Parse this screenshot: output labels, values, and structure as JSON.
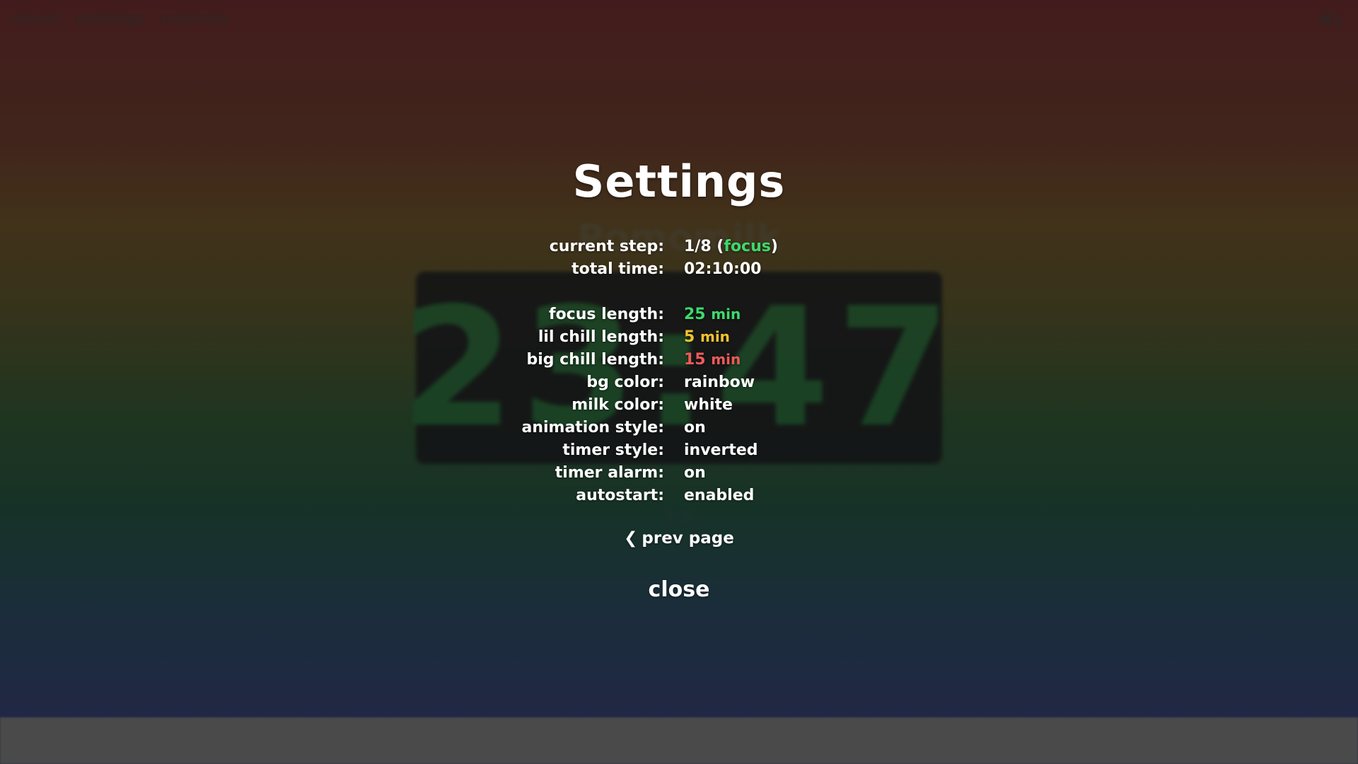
{
  "background": {
    "nav": {
      "about": "about",
      "settings": "settings",
      "controls": "controls"
    },
    "app_title": "Pomomilk",
    "timer": "23:47",
    "step": "1/8"
  },
  "settings": {
    "title": "Settings",
    "current_step_label": "current step:",
    "current_step_value": "1/8 (",
    "current_step_phase": "focus",
    "current_step_close": ")",
    "total_time_label": "total time:",
    "total_time_value": "02:10:00",
    "focus_length_label": "focus length:",
    "focus_length_value": "25",
    "focus_length_unit": "min",
    "lil_chill_label": "lil chill length:",
    "lil_chill_value": "5",
    "lil_chill_unit": "min",
    "big_chill_label": "big chill length:",
    "big_chill_value": "15",
    "big_chill_unit": "min",
    "bg_color_label": "bg color:",
    "bg_color_value": "rainbow",
    "milk_color_label": "milk color:",
    "milk_color_value": "white",
    "animation_style_label": "animation style:",
    "animation_style_value": "on",
    "timer_style_label": "timer style:",
    "timer_style_value": "inverted",
    "timer_alarm_label": "timer alarm:",
    "timer_alarm_value": "on",
    "autostart_label": "autostart:",
    "autostart_value": "enabled",
    "prev_page": "prev page",
    "close": "close"
  },
  "icons": {
    "volume": "volume-icon",
    "prev": "chevron-left-icon"
  },
  "colors": {
    "focus": "#3ed96a",
    "lil_chill": "#f2c230",
    "big_chill": "#ef5a5a"
  }
}
